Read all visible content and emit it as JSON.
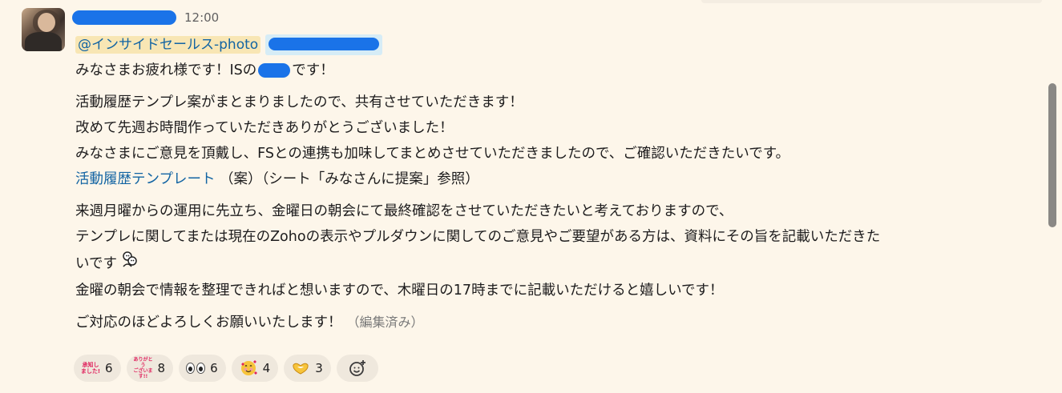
{
  "message": {
    "timestamp": "12:00",
    "mention": "@インサイドセールス-photo",
    "lines": {
      "l1a": "みなさまお疲れ様です！ISの",
      "l1b": "です！",
      "l2": "活動履歴テンプレ案がまとまりましたので、共有させていただきます！",
      "l3": "改めて先週お時間作っていただきありがとうございました！",
      "l4": "みなさまにご意見を頂戴し、FSとの連携も加味してまとめさせていただきましたので、ご確認いただきたいです。",
      "l5_link": "活動履歴テンプレート",
      "l5_rest": " （案）（シート「みなさんに提案」参照）",
      "l6": "来週月曜からの運用に先立ち、金曜日の朝会にて最終確認をさせていただきたいと考えておりますので、",
      "l7": "テンプレに関してまたは現在のZohoの表示やプルダウンに関してのご意見やご要望がある方は、資料にその旨を記載いただきた",
      "l8": "いです",
      "l9": "金曜の朝会で情報を整理できればと想いますので、木曜日の17時までに記載いただけると嬉しいです！",
      "l10": "ご対応のほどよろしくお願いいたします！",
      "edited": "（編集済み）"
    }
  },
  "reactions": [
    {
      "icon": "shouchi-shimashita-stamp",
      "stamp_text": "承知し\nました!",
      "count": "6"
    },
    {
      "icon": "arigatou-gozaimasu-stamp",
      "stamp_text": "ありがとう\nございます!!",
      "count": "8"
    },
    {
      "icon": "eyes-icon",
      "count": "6"
    },
    {
      "icon": "smiling-face-with-hearts-icon",
      "emoji": "🥰",
      "count": "4"
    },
    {
      "icon": "heart-hands-icon",
      "count": "3"
    }
  ],
  "colors": {
    "background": "#fdf6ea",
    "link": "#1264a3",
    "mention_bg": "#f8e6b4",
    "reaction_bg": "#efe8dd",
    "redaction": "#1a73e8"
  }
}
